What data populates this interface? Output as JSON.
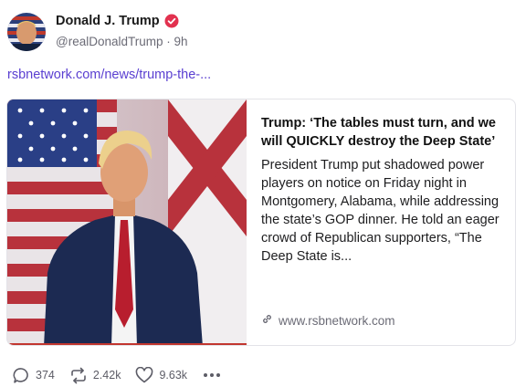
{
  "author": {
    "name": "Donald J. Trump",
    "handle": "@realDonaldTrump",
    "separator": "·",
    "time": "9h",
    "verified": true
  },
  "post": {
    "link_text": "rsbnetwork.com/news/trump-the-..."
  },
  "card": {
    "title": "Trump: ‘The tables must turn, and we will QUICKLY destroy the Deep State’",
    "description": "President Trump put shadowed power players on notice on Friday night in Montgomery, Alabama, while addressing the state’s GOP dinner. He told an eager crowd of Republican supporters, “The Deep State is...",
    "domain": "www.rsbnetwork.com",
    "image_subject": "man in navy suit and red tie in front of flags"
  },
  "actions": {
    "replies": "374",
    "reposts": "2.42k",
    "likes": "9.63k"
  },
  "icons": {
    "verified": "verified-badge-icon",
    "reply": "speech-bubble-icon",
    "repost": "repost-arrows-icon",
    "like": "heart-icon",
    "more": "more-dots-icon",
    "link": "chain-link-icon"
  },
  "colors": {
    "link": "#5a3fd1",
    "verified": "#e2314f",
    "muted": "#6b6b76"
  }
}
